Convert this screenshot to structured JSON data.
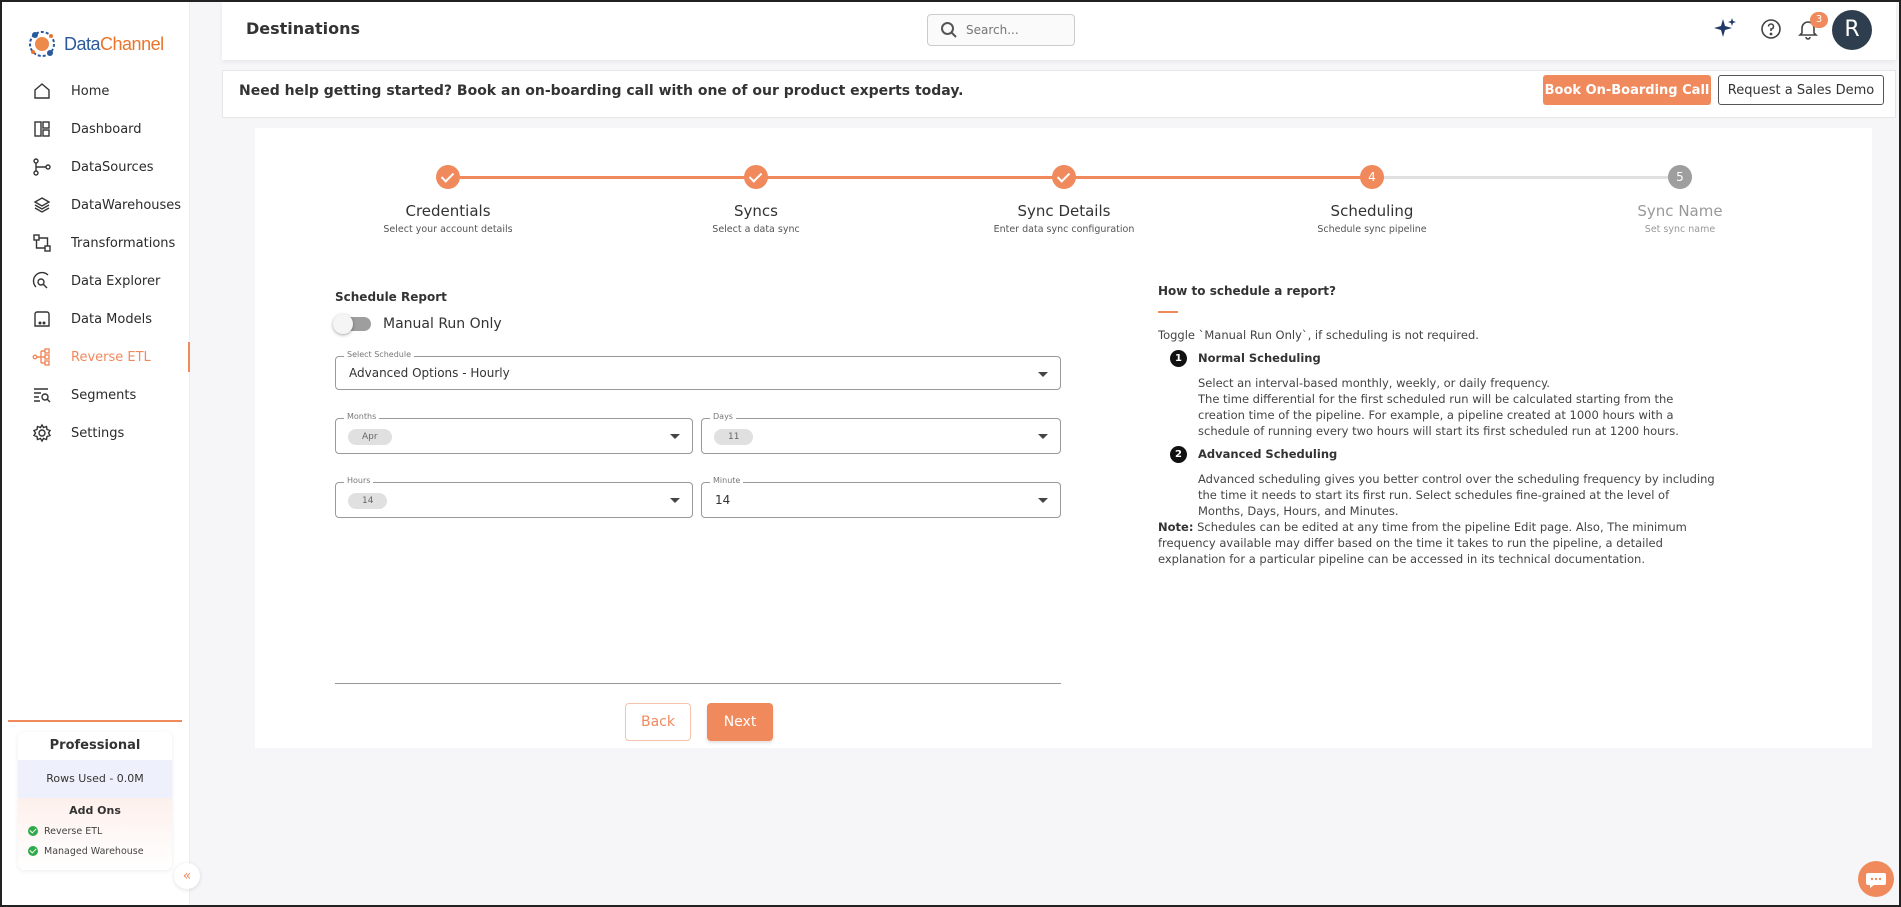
{
  "brand": {
    "name_part1": "Data",
    "name_part2": "Channel",
    "color_primary": "#2a5a9c",
    "color_accent": "#e9742b"
  },
  "theme": {
    "accent": "#f08a5d",
    "done_color": "#f08a5d",
    "pending_color": "#9e9e9e"
  },
  "sidebar": {
    "items": [
      {
        "label": "Home",
        "icon": "home-icon"
      },
      {
        "label": "Dashboard",
        "icon": "dashboard-icon"
      },
      {
        "label": "DataSources",
        "icon": "datasources-icon"
      },
      {
        "label": "DataWarehouses",
        "icon": "layers-icon"
      },
      {
        "label": "Transformations",
        "icon": "transformations-icon"
      },
      {
        "label": "Data Explorer",
        "icon": "explorer-icon"
      },
      {
        "label": "Data Models",
        "icon": "data-models-icon"
      },
      {
        "label": "Reverse ETL",
        "icon": "reverse-etl-icon",
        "active": true
      },
      {
        "label": "Segments",
        "icon": "segments-icon"
      },
      {
        "label": "Settings",
        "icon": "settings-icon"
      }
    ],
    "plan": {
      "title": "Professional",
      "rows_used": "Rows Used - 0.0M",
      "addons_title": "Add Ons",
      "addons": [
        "Reverse ETL",
        "Managed Warehouse"
      ]
    }
  },
  "header": {
    "title": "Destinations",
    "search_placeholder": "Search...",
    "notification_count": "3",
    "avatar_initial": "R"
  },
  "banner": {
    "text": "Need help getting started? Book an on-boarding call with one of our product experts today.",
    "book_label": "Book On-Boarding Call",
    "demo_label": "Request a Sales Demo"
  },
  "stepper": {
    "current_step": 4,
    "steps": [
      {
        "label": "Credentials",
        "sub": "Select your account details",
        "status": "done"
      },
      {
        "label": "Syncs",
        "sub": "Select a data sync",
        "status": "done"
      },
      {
        "label": "Sync Details",
        "sub": "Enter data sync configuration",
        "status": "done"
      },
      {
        "label": "Scheduling",
        "sub": "Schedule sync pipeline",
        "status": "current",
        "number": "4"
      },
      {
        "label": "Sync Name",
        "sub": "Set sync name",
        "status": "pending",
        "number": "5"
      }
    ]
  },
  "form": {
    "title": "Schedule Report",
    "manual_toggle_label": "Manual Run Only",
    "manual_toggle_on": false,
    "select_schedule": {
      "label": "Select Schedule",
      "value": "Advanced Options - Hourly"
    },
    "months": {
      "label": "Months",
      "chip": "Apr"
    },
    "days": {
      "label": "Days",
      "chip": "11"
    },
    "hours": {
      "label": "Hours",
      "chip": "14"
    },
    "minute": {
      "label": "Minute",
      "value": "14"
    },
    "back_label": "Back",
    "next_label": "Next"
  },
  "help": {
    "title": "How to schedule a report?",
    "intro": "Toggle `Manual Run Only`, if scheduling is not required.",
    "sections": [
      {
        "num": "1",
        "title": "Normal Scheduling",
        "body1": "Select an interval-based monthly, weekly, or daily frequency.",
        "body2": "The time differential for the first scheduled run will be calculated starting from the creation time of the pipeline. For example, a pipeline created at 1000 hours with a schedule of running every two hours will start its first scheduled run at 1200 hours."
      },
      {
        "num": "2",
        "title": "Advanced Scheduling",
        "body1": "Advanced scheduling gives you better control over the scheduling frequency by including the time it needs to start its first run. Select schedules fine-grained at the level of Months, Days, Hours, and Minutes."
      }
    ],
    "note_label": "Note:",
    "note_text": " Schedules can be edited at any time from the pipeline Edit page. Also, The minimum frequency available may differ based on the time it takes to run the pipeline, a detailed explanation for a particular pipeline can be accessed in its technical documentation."
  }
}
